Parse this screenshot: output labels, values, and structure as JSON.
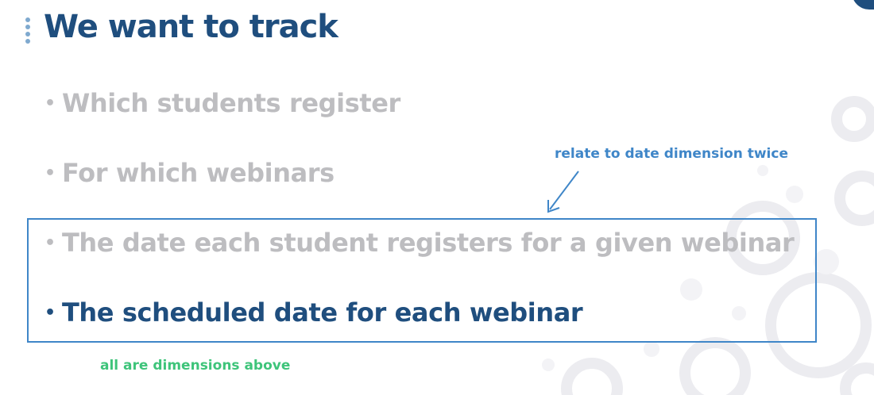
{
  "slide": {
    "title": "We want to track",
    "bullets": [
      {
        "text": "Which students register",
        "emphasis": "muted"
      },
      {
        "text": "For which webinars",
        "emphasis": "muted"
      },
      {
        "text": "The date each student registers for a given webinar",
        "emphasis": "muted"
      },
      {
        "text": "The scheduled date for each webinar",
        "emphasis": "strong"
      }
    ],
    "bullet_glyph": "•"
  },
  "annotations": {
    "top_note": "relate to date dimension twice",
    "bottom_note": "all are dimensions above"
  },
  "colors": {
    "title": "#1f4e7e",
    "muted_text": "#bdbdc0",
    "strong_text": "#1f4e7e",
    "annotation_blue": "#3f86c8",
    "annotation_green": "#3ec47a",
    "box_border": "#3f86c8",
    "title_dots": "#7fa9cf",
    "decor_circles": "#ececf0",
    "corner_accent": "#1f4e7e"
  },
  "icons": {
    "title_marker": "vertical-dots-icon",
    "annotation_pointer": "arrow-icon",
    "background": "bubble-circles-decoration"
  }
}
